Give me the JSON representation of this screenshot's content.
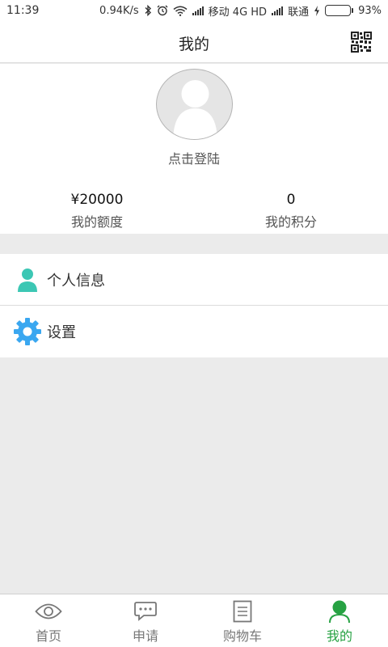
{
  "status_bar": {
    "time": "11:39",
    "speed": "0.94K/s",
    "carrier1": "移动 4G HD",
    "carrier2": "联通",
    "battery": "93%",
    "battery_level": 0.93
  },
  "header": {
    "title": "我的",
    "qr_icon": "qr-code-icon"
  },
  "profile": {
    "login_text": "点击登陆",
    "stats": [
      {
        "value": "¥20000",
        "label": "我的额度"
      },
      {
        "value": "0",
        "label": "我的积分"
      }
    ]
  },
  "menu": {
    "items": [
      {
        "label": "个人信息",
        "icon": "person-icon"
      },
      {
        "label": "设置",
        "icon": "gear-icon"
      }
    ]
  },
  "tabs": [
    {
      "label": "首页",
      "icon": "eye-icon"
    },
    {
      "label": "申请",
      "icon": "chat-bubble-icon"
    },
    {
      "label": "购物车",
      "icon": "document-icon"
    },
    {
      "label": "我的",
      "icon": "person-icon",
      "active": true
    }
  ],
  "colors": {
    "accent": "#27a243",
    "person_icon": "#3cc7b4",
    "gear_icon": "#3aa7f0",
    "battery": "#49b649"
  }
}
